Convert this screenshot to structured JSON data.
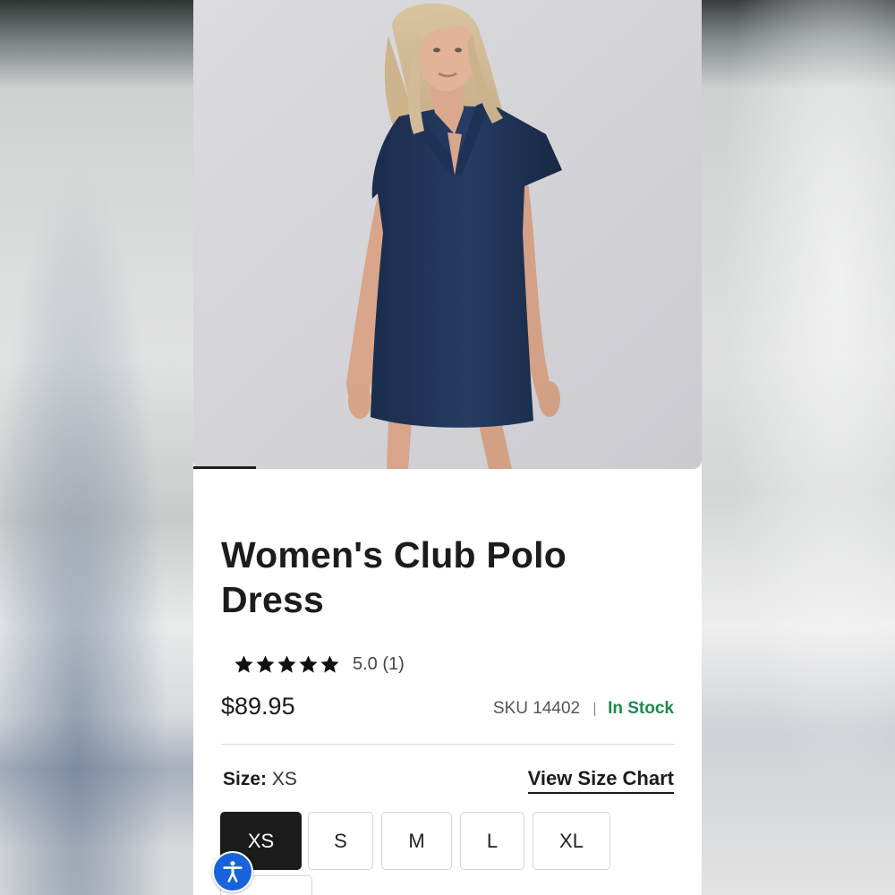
{
  "product": {
    "image_alt": "Woman wearing navy polo dress",
    "title": "Women's Club Polo Dress",
    "rating": {
      "stars": 5,
      "max_stars": 5,
      "text": "5.0 (1)"
    },
    "price": "$89.95",
    "sku": "SKU 14402",
    "stock_status": "In Stock",
    "stock_color": "#1f8a50",
    "gallery": {
      "current_slide": 1
    }
  },
  "size": {
    "label": "Size:",
    "selected_value": "XS",
    "chart_link": "View Size Chart",
    "options": [
      "XS",
      "S",
      "M",
      "L",
      "XL"
    ]
  },
  "accessibility": {
    "icon": "accessibility-icon",
    "color": "#1863dc"
  }
}
